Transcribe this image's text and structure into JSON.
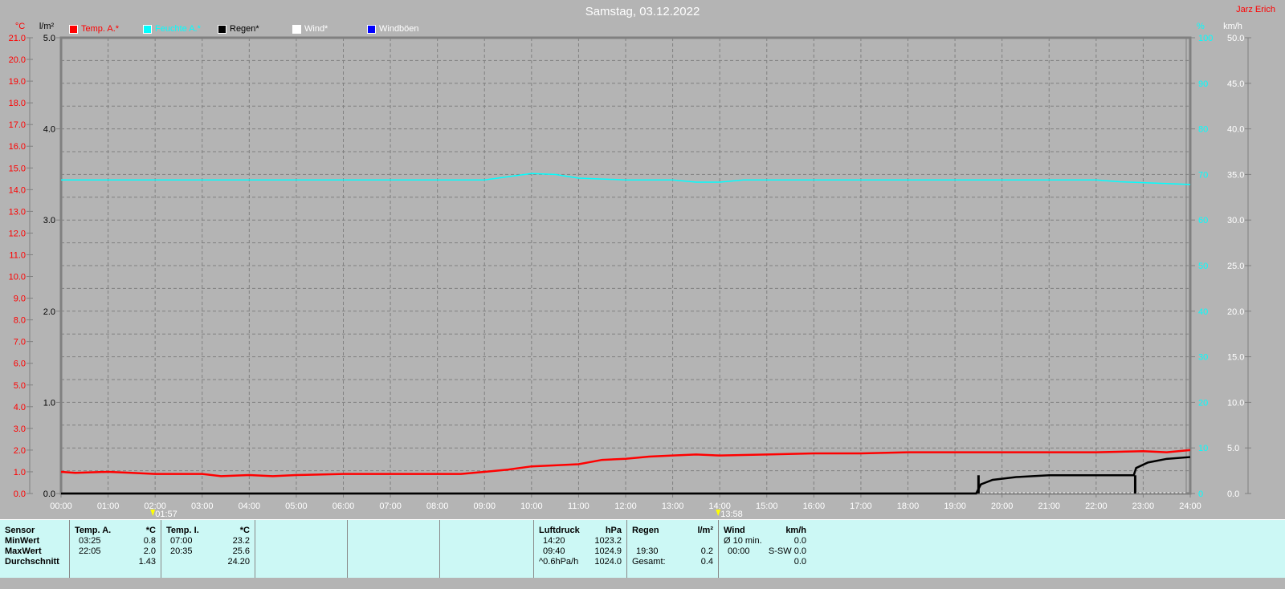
{
  "title": "Samstag, 03.12.2022",
  "author": "Jarz Erich",
  "legend": [
    {
      "label": "Temp. A.*",
      "color": "#ff0000"
    },
    {
      "label": "Feuchte A.*",
      "color": "#00ffff"
    },
    {
      "label": "Regen*",
      "color": "#000000"
    },
    {
      "label": "Wind*",
      "color": "#ffffff"
    },
    {
      "label": "Windböen",
      "color": "#0000ff"
    }
  ],
  "chart_data": {
    "type": "line",
    "axes": {
      "temp": {
        "unit": "°C",
        "range": [
          0,
          21
        ],
        "step": 1,
        "color": "#ff0000"
      },
      "rain": {
        "unit": "l/m²",
        "range": [
          0,
          5
        ],
        "step": 1,
        "color": "#000000"
      },
      "humidity": {
        "unit": "%",
        "range": [
          0,
          100
        ],
        "step": 10,
        "color": "#00ffff"
      },
      "wind": {
        "unit": "km/h",
        "range": [
          0,
          50
        ],
        "step": 5,
        "color": "#ffffff"
      }
    },
    "x_ticks": [
      "00:00",
      "01:00",
      "02:00",
      "03:00",
      "04:00",
      "05:00",
      "06:00",
      "07:00",
      "08:00",
      "09:00",
      "10:00",
      "11:00",
      "12:00",
      "13:00",
      "14:00",
      "15:00",
      "16:00",
      "17:00",
      "18:00",
      "19:00",
      "20:00",
      "21:00",
      "22:00",
      "23:00",
      "24:00"
    ],
    "grid": true,
    "markers": [
      {
        "time": "01:57",
        "label": "01:57"
      },
      {
        "time": "13:58",
        "label": "13:58"
      }
    ],
    "series": [
      {
        "name": "Temp. A.*",
        "axis": "temp",
        "color": "#ff0000",
        "x": [
          0,
          0.3,
          1,
          1.5,
          2,
          3,
          3.4,
          4,
          4.5,
          5,
          6,
          7,
          8,
          8.5,
          9,
          9.5,
          10,
          11,
          11.5,
          12,
          12.5,
          13,
          13.5,
          14,
          15,
          16,
          17,
          18,
          19,
          20,
          21,
          22,
          23,
          23.5,
          24
        ],
        "y": [
          1.0,
          0.95,
          1.0,
          0.95,
          0.9,
          0.9,
          0.8,
          0.85,
          0.8,
          0.85,
          0.9,
          0.9,
          0.9,
          0.9,
          1.0,
          1.1,
          1.25,
          1.35,
          1.55,
          1.6,
          1.7,
          1.75,
          1.8,
          1.75,
          1.8,
          1.85,
          1.85,
          1.9,
          1.9,
          1.9,
          1.9,
          1.9,
          1.95,
          1.9,
          2.0
        ]
      },
      {
        "name": "Feuchte A.*",
        "axis": "humidity",
        "color": "#00ffff",
        "x": [
          0,
          9,
          9.5,
          10,
          10.5,
          11,
          12,
          13,
          13.5,
          14,
          14.5,
          15,
          22,
          22.5,
          23,
          24
        ],
        "y": [
          68.8,
          68.8,
          69.5,
          70.2,
          70.0,
          69.2,
          68.8,
          68.8,
          68.3,
          68.3,
          68.8,
          68.8,
          68.8,
          68.4,
          68.2,
          67.8
        ]
      },
      {
        "name": "Regen*",
        "axis": "rain",
        "color": "#000000",
        "x": [
          0,
          19.45,
          19.55,
          19.8,
          20.3,
          21,
          22.8,
          22.85,
          23.1,
          23.5,
          24
        ],
        "y": [
          0,
          0,
          0.1,
          0.15,
          0.18,
          0.2,
          0.2,
          0.28,
          0.34,
          0.38,
          0.4
        ]
      },
      {
        "axis": "rain",
        "color": "#000000",
        "type": "bar",
        "x": [
          19.5,
          22.83
        ],
        "y": [
          0.2,
          0.2
        ]
      }
    ]
  },
  "stats": {
    "sensor": {
      "head": "Sensor",
      "rows": [
        "MinWert",
        "MaxWert",
        "Durchschnitt"
      ]
    },
    "temp_a": {
      "head": "Temp. A.",
      "unit": "*C",
      "rows": [
        [
          "03:25",
          "0.8"
        ],
        [
          "22:05",
          "2.0"
        ],
        [
          "",
          "1.43"
        ]
      ]
    },
    "temp_i": {
      "head": "Temp. I.",
      "unit": "*C",
      "rows": [
        [
          "07:00",
          "23.2"
        ],
        [
          "20:35",
          "25.6"
        ],
        [
          "",
          "24.20"
        ]
      ]
    },
    "luftdruck": {
      "head": "Luftdruck",
      "unit": "hPa",
      "rows": [
        [
          "14:20",
          "1023.2"
        ],
        [
          "09:40",
          "1024.9"
        ],
        [
          "^0.6hPa/h",
          "1024.0"
        ]
      ]
    },
    "regen": {
      "head": "Regen",
      "unit": "l/m²",
      "rows": [
        [
          "",
          ""
        ],
        [
          "19:30",
          "0.2"
        ],
        [
          "Gesamt:",
          "0.4"
        ]
      ]
    },
    "wind": {
      "head": "Wind",
      "unit": "km/h",
      "rows": [
        [
          "Ø 10 min.",
          "0.0"
        ],
        [
          "00:00",
          "S-SW 0.0"
        ],
        [
          "",
          "0.0"
        ]
      ]
    }
  }
}
